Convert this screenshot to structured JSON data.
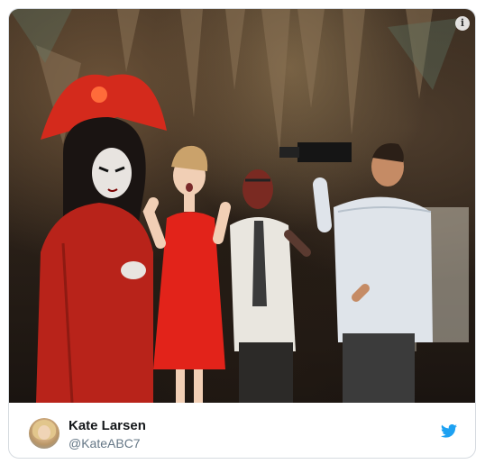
{
  "tweet": {
    "author_name": "Kate Larsen",
    "author_handle": "@KateABC7",
    "info_glyph": "i",
    "brand_color": "#1da1f2"
  },
  "icons": {
    "info": "info-icon",
    "brand": "twitter-bird-icon"
  }
}
